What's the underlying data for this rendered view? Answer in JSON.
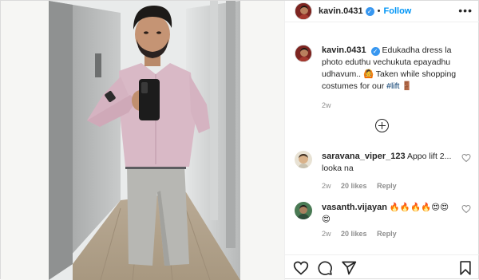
{
  "post": {
    "username": "kavin.0431",
    "follow_label": "Follow",
    "separator": "•",
    "more_label": "•••"
  },
  "caption": {
    "username": "kavin.0431",
    "text_before": "Edukadha dress la photo eduthu vechukuta epayadhu udhavum.. 🙆 Taken while shopping costumes for our ",
    "hashtag": "#lift",
    "text_after": " 🚪",
    "time": "2w"
  },
  "comments": [
    {
      "username": "saravana_viper_123",
      "text": "Appo lift 2... looka na",
      "time": "2w",
      "likes": "20 likes",
      "reply": "Reply"
    },
    {
      "username": "vasanth.vijayan",
      "text": "🔥🔥🔥🔥😍😍",
      "text_line2": "😍",
      "time": "2w",
      "likes": "20 likes",
      "reply": "Reply"
    }
  ],
  "icons": {
    "verified": "verified-badge-icon",
    "more": "more-options-icon",
    "load_more": "plus-circle-icon",
    "like": "heart-icon",
    "comment": "comment-icon",
    "share": "share-icon",
    "save": "bookmark-icon"
  },
  "colors": {
    "accent": "#0095f6",
    "verified": "#3897f0",
    "text": "#262626",
    "muted": "#8e8e8e"
  }
}
